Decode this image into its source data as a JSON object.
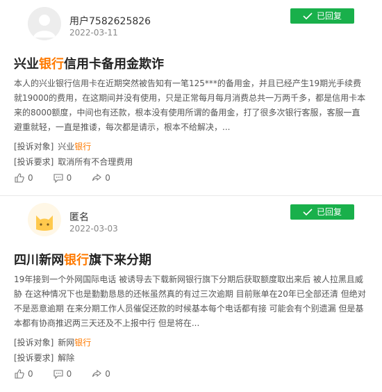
{
  "complaints": [
    {
      "user": "用户7582625826",
      "date": "2022-03-11",
      "status": "已回复",
      "title_before": "兴业",
      "title_highlight": "银行",
      "title_after": "信用卡备用金欺诈",
      "description": "本人的兴业银行信用卡在近期突然被告知有一笔125***的备用金，并且已经产生19期光手续费就19000的费用，在这期间并没有使用，只是正常每月每月消费总共一万两千多，都是信用卡本来的8000额度，中间也有还款，根本没有使用所谓的备用金，打了很多次银行客服，客服一直避重就轻，一直是推诿，每次都是请示，根本不给解决，...",
      "target_label": "[投诉对象]",
      "target_before": "兴业",
      "target_highlight": "银行",
      "request_label": "[投诉要求]",
      "request_value": "取消所有不合理费用",
      "likes": "0",
      "comments": "0",
      "shares": "0"
    },
    {
      "user": "匿名",
      "date": "2022-03-03",
      "status": "已回复",
      "title_before": "四川新网",
      "title_highlight": "银行",
      "title_after": "旗下来分期",
      "description": "19年接到一个外网国际电话 被诱导去下载新网银行旗下分期后获取额度取出来后 被人拉黑且威胁 在这种情况下也是勤勤恳恳的还帐虽然真的有过三次逾期 目前账单在20年已全部还清 但绝对不是恶意逾期 在来分期工作人员催促还款的时候基本每个电话都有接 可能会有个别遗漏 但是基本都有协商推迟两三天还及不上报中行 但是将在...",
      "target_label": "[投诉对象]",
      "target_before": "新网",
      "target_highlight": "银行",
      "request_label": "[投诉要求]",
      "request_value": "解除",
      "likes": "0",
      "comments": "0",
      "shares": "0"
    }
  ],
  "colors": {
    "accent": "#ff7a00",
    "badge": "#19b04b"
  },
  "icons": [
    "check-icon",
    "like-icon",
    "comment-icon",
    "share-icon",
    "default-avatar-icon",
    "cat-avatar-icon"
  ]
}
